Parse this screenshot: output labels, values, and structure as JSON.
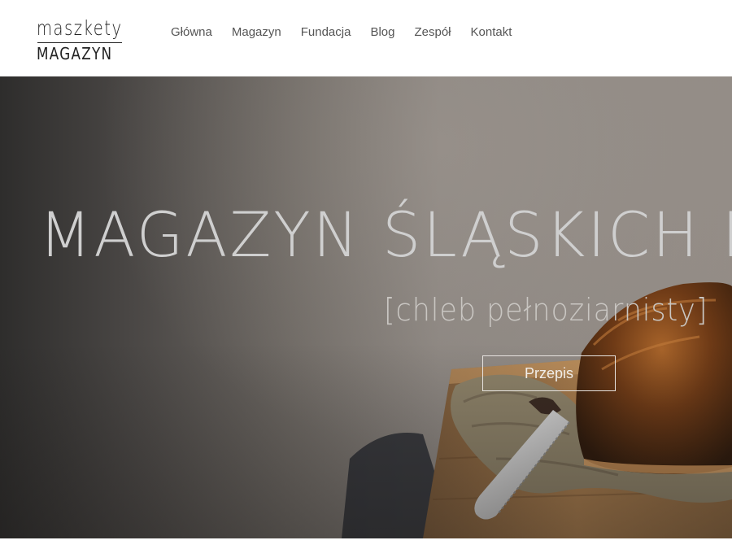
{
  "brand": {
    "logo_line1": "maszkety",
    "logo_line2": "MAGAZYN"
  },
  "nav": {
    "items": [
      {
        "label": "Główna"
      },
      {
        "label": "Magazyn"
      },
      {
        "label": "Fundacja"
      },
      {
        "label": "Blog"
      },
      {
        "label": "Zespół"
      },
      {
        "label": "Kontakt"
      }
    ]
  },
  "hero": {
    "title": "MAGAZYN ŚLĄSKICH B",
    "subtitle": "[chleb pełnoziarnisty]",
    "button_label": "Przepis"
  },
  "colors": {
    "header_bg": "#ffffff",
    "nav_text": "#555555",
    "hero_title": "#cfcfcf",
    "button_border": "#e6e2de"
  }
}
